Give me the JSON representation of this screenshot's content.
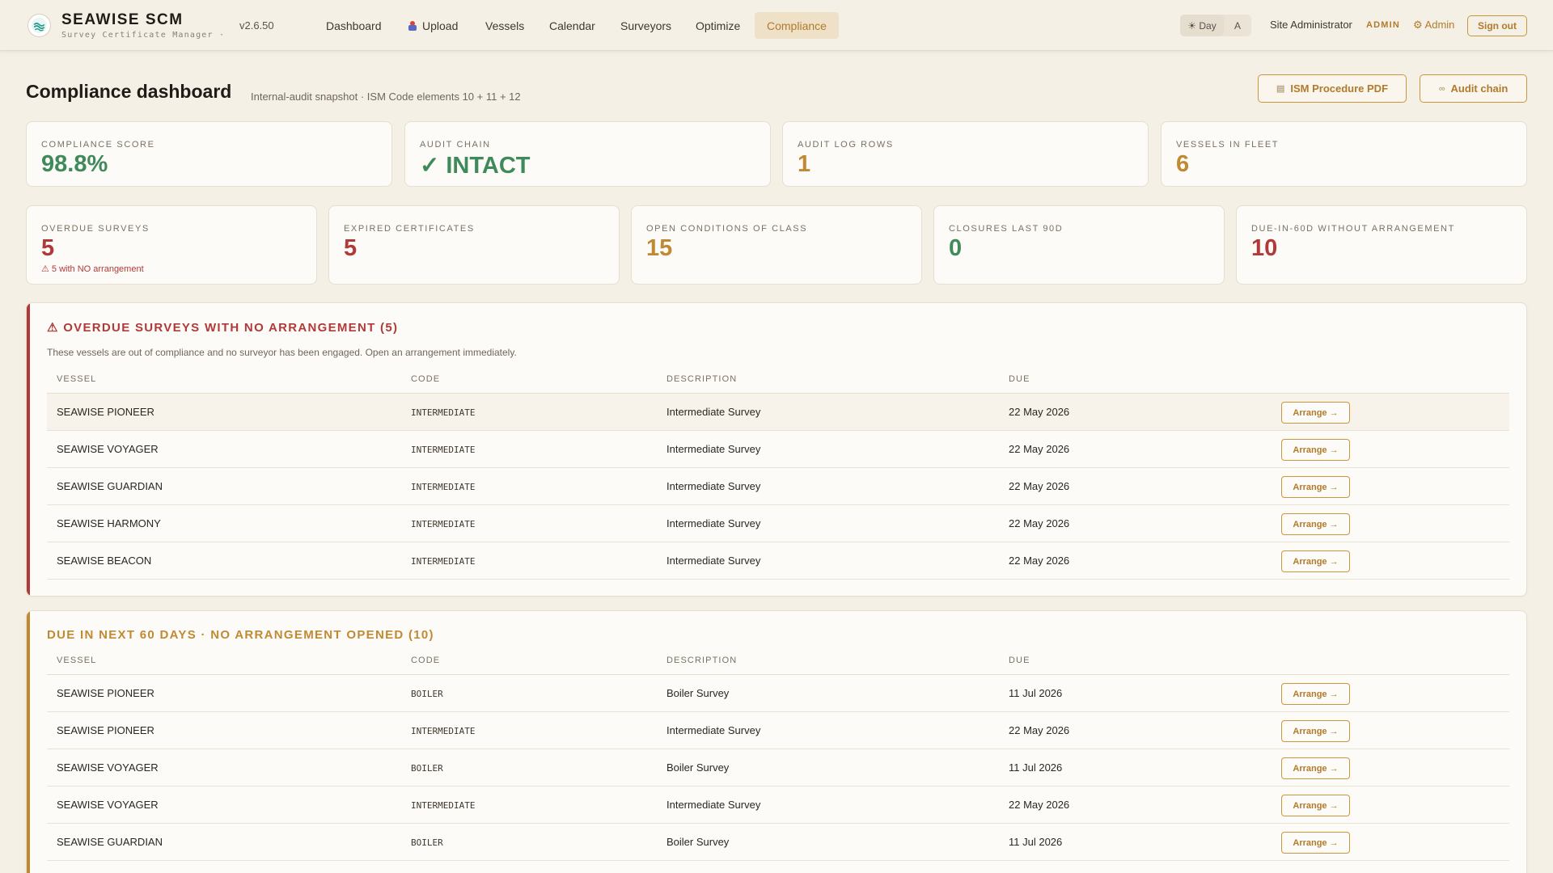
{
  "app": {
    "name": "SEAWISE SCM",
    "subtitle": "Survey Certificate Manager ·",
    "version": "v2.6.50"
  },
  "nav": {
    "items": [
      {
        "label": "Dashboard"
      },
      {
        "label": "Upload"
      },
      {
        "label": "Vessels"
      },
      {
        "label": "Calendar"
      },
      {
        "label": "Surveyors"
      },
      {
        "label": "Optimize"
      },
      {
        "label": "Compliance",
        "active": true
      }
    ]
  },
  "theme": {
    "day_label": "☀ Day",
    "auto_label": "A"
  },
  "user": {
    "name": "Site Administrator",
    "role": "ADMIN",
    "admin_link": "⚙ Admin",
    "signout": "Sign out"
  },
  "page": {
    "title": "Compliance dashboard",
    "subtitle": "Internal-audit snapshot · ISM Code elements 10 + 11 + 12",
    "buttons": {
      "ism_pdf": "ISM Procedure PDF",
      "audit_chain": "Audit chain"
    }
  },
  "colors": {
    "accent": "#b07b2c",
    "good": "#3f8a5a",
    "bad": "#b03a3a",
    "warn": "#c08a34"
  },
  "stats_top": [
    {
      "label": "COMPLIANCE SCORE",
      "value": "98.8%",
      "tone": "good"
    },
    {
      "label": "AUDIT CHAIN",
      "value": "✓ INTACT",
      "tone": "good"
    },
    {
      "label": "AUDIT LOG ROWS",
      "value": "1",
      "tone": "warn"
    },
    {
      "label": "VESSELS IN FLEET",
      "value": "6",
      "tone": "warn"
    }
  ],
  "stats_bottom": [
    {
      "label": "OVERDUE SURVEYS",
      "value": "5",
      "tone": "bad",
      "note": "⚠ 5 with NO arrangement"
    },
    {
      "label": "EXPIRED CERTIFICATES",
      "value": "5",
      "tone": "bad"
    },
    {
      "label": "OPEN CONDITIONS OF CLASS",
      "value": "15",
      "tone": "warn"
    },
    {
      "label": "CLOSURES LAST 90D",
      "value": "0",
      "tone": "good"
    },
    {
      "label": "DUE-IN-60D WITHOUT ARRANGEMENT",
      "value": "10",
      "tone": "bad"
    }
  ],
  "overdue": {
    "title": "⚠ OVERDUE SURVEYS WITH NO ARRANGEMENT (5)",
    "description": "These vessels are out of compliance and no surveyor has been engaged. Open an arrangement immediately.",
    "columns": {
      "vessel": "VESSEL",
      "code": "CODE",
      "description": "DESCRIPTION",
      "due": "DUE"
    },
    "action_label": "Arrange →",
    "rows": [
      {
        "vessel": "SEAWISE PIONEER",
        "code": "INTERMEDIATE",
        "description": "Intermediate Survey",
        "due": "22 May 2026"
      },
      {
        "vessel": "SEAWISE VOYAGER",
        "code": "INTERMEDIATE",
        "description": "Intermediate Survey",
        "due": "22 May 2026"
      },
      {
        "vessel": "SEAWISE GUARDIAN",
        "code": "INTERMEDIATE",
        "description": "Intermediate Survey",
        "due": "22 May 2026"
      },
      {
        "vessel": "SEAWISE HARMONY",
        "code": "INTERMEDIATE",
        "description": "Intermediate Survey",
        "due": "22 May 2026"
      },
      {
        "vessel": "SEAWISE BEACON",
        "code": "INTERMEDIATE",
        "description": "Intermediate Survey",
        "due": "22 May 2026"
      }
    ]
  },
  "due_soon": {
    "title": "DUE IN NEXT 60 DAYS · NO ARRANGEMENT OPENED (10)",
    "columns": {
      "vessel": "VESSEL",
      "code": "CODE",
      "description": "DESCRIPTION",
      "due": "DUE"
    },
    "action_label": "Arrange →",
    "rows": [
      {
        "vessel": "SEAWISE PIONEER",
        "code": "BOILER",
        "description": "Boiler Survey",
        "due": "11 Jul 2026"
      },
      {
        "vessel": "SEAWISE PIONEER",
        "code": "INTERMEDIATE",
        "description": "Intermediate Survey",
        "due": "22 May 2026"
      },
      {
        "vessel": "SEAWISE VOYAGER",
        "code": "BOILER",
        "description": "Boiler Survey",
        "due": "11 Jul 2026"
      },
      {
        "vessel": "SEAWISE VOYAGER",
        "code": "INTERMEDIATE",
        "description": "Intermediate Survey",
        "due": "22 May 2026"
      },
      {
        "vessel": "SEAWISE GUARDIAN",
        "code": "BOILER",
        "description": "Boiler Survey",
        "due": "11 Jul 2026"
      }
    ]
  }
}
